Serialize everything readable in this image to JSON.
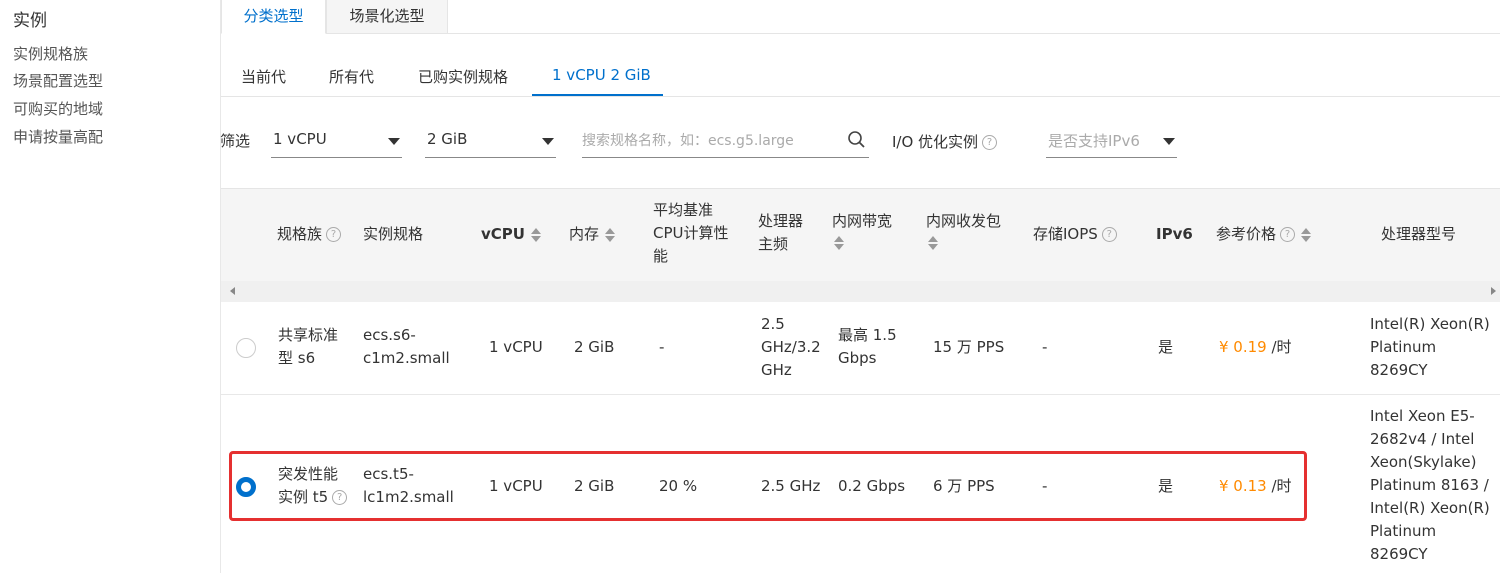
{
  "sidebar": {
    "title": "实例",
    "items": [
      "实例规格族",
      "场景配置选型",
      "可购买的地域",
      "申请按量高配"
    ]
  },
  "top_tabs": [
    "分类选型",
    "场景化选型"
  ],
  "sub_tabs": [
    "当前代",
    "所有代",
    "已购实例规格",
    "1 vCPU 2 GiB"
  ],
  "filters": {
    "label": "筛选",
    "vcpu": "1 vCPU",
    "memory": "2 GiB",
    "search_placeholder": "搜索规格名称，如：ecs.g5.large",
    "io_label": "I/O 优化实例",
    "ipv6_placeholder": "是否支持IPv6"
  },
  "table": {
    "headers": {
      "family": "规格族",
      "spec": "实例规格",
      "vcpu": "vCPU",
      "memory": "内存",
      "baseline_1": "平均基准",
      "baseline_2": "CPU计算性",
      "baseline_3": "能",
      "freq_1": "处理器",
      "freq_2": "主频",
      "bandwidth": "内网带宽",
      "pps": "内网收发包",
      "iops": "存储IOPS",
      "ipv6": "IPv6",
      "price": "参考价格",
      "cpu_model": "处理器型号"
    },
    "rows": [
      {
        "family_1": "共享标准",
        "family_2": "型 s6",
        "spec_1": "ecs.s6-",
        "spec_2": "c1m2.small",
        "vcpu": "1 vCPU",
        "memory": "2 GiB",
        "baseline": "-",
        "freq_1": "2.5",
        "freq_2": "GHz/3.2",
        "freq_3": "GHz",
        "bandwidth_1": "最高 1.5",
        "bandwidth_2": "Gbps",
        "pps": "15 万 PPS",
        "iops": "-",
        "ipv6": "是",
        "price": "¥ 0.19",
        "price_unit": "/时",
        "cpu_1": "Intel(R) Xeon(R)",
        "cpu_2": "Platinum",
        "cpu_3": "8269CY",
        "selected": false
      },
      {
        "family_1": "突发性能",
        "family_2": "实例 t5",
        "spec_1": "ecs.t5-",
        "spec_2": "lc1m2.small",
        "vcpu": "1 vCPU",
        "memory": "2 GiB",
        "baseline": "20 %",
        "freq": "2.5 GHz",
        "bandwidth": "0.2 Gbps",
        "pps": "6 万 PPS",
        "iops": "-",
        "ipv6": "是",
        "price": "¥ 0.13",
        "price_unit": "/时",
        "cpu_1": "Intel Xeon E5-",
        "cpu_2": "2682v4 / Intel",
        "cpu_3": "Xeon(Skylake)",
        "cpu_4": "Platinum 8163 /",
        "cpu_5": "Intel(R) Xeon(R)",
        "cpu_6": "Platinum",
        "cpu_7": "8269CY",
        "selected": true
      }
    ]
  },
  "colors": {
    "accent": "#0070cc",
    "price": "#ff8a00",
    "highlight": "#e53030"
  }
}
